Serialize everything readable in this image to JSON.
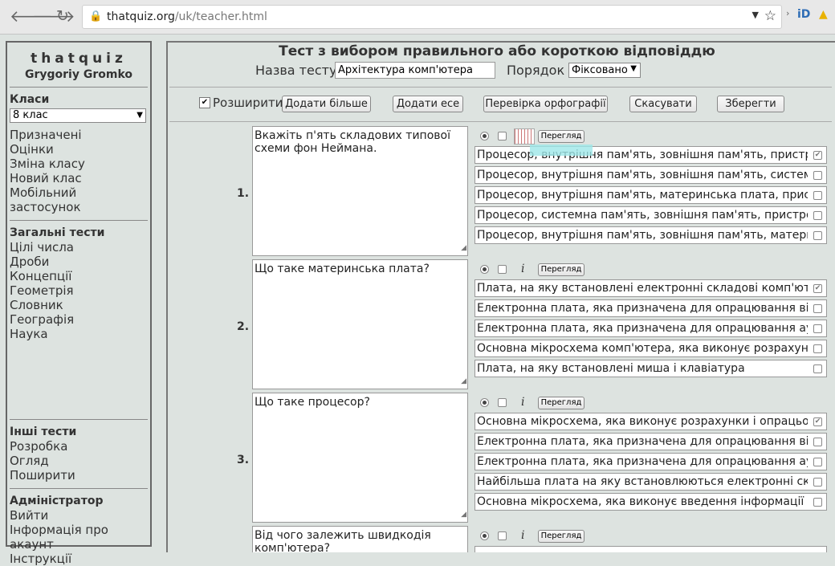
{
  "browser": {
    "url_host": "thatquiz.org",
    "url_path": "/uk/teacher.html"
  },
  "sidebar": {
    "logo": "thatquiz",
    "owner": "Grygoriy Gromko",
    "classes_heading": "Класи",
    "class_selected": "8 клас",
    "class_links": [
      "Призначені",
      "Оцінки",
      "Зміна класу",
      "Новий клас",
      "Мобільний застосунок"
    ],
    "general_heading": "Загальні тести",
    "general_links": [
      "Цілі числа",
      "Дроби",
      "Концепції",
      "Геометрія",
      "Словник",
      "Географія",
      "Наука"
    ],
    "other_heading": "Інші тести",
    "other_links": [
      "Розробка",
      "Огляд",
      "Поширити"
    ],
    "admin_heading": "Адміністратор",
    "admin_links": [
      "Вийти",
      "Інформація про акаунт",
      "Інструкції"
    ]
  },
  "main": {
    "title": "Тест з вибором правильного або короткою відповіддю",
    "name_label": "Назва тесту :",
    "name_value": "Архітектура комп'ютера",
    "order_label": "Порядок :",
    "order_value": "Фіксовано",
    "expand_label": "Розширити",
    "buttons": {
      "add_more": "Додати більше",
      "add_all": "Додати есе",
      "spellcheck": "Перевірка орфографії",
      "cancel": "Скасувати",
      "save": "Зберегти"
    },
    "preview_label": "Перегляд",
    "info_symbol": "i",
    "questions": [
      {
        "number": "1.",
        "text": "Вкажіть п'ять складових типової схеми фон Неймана.",
        "answers": [
          "Процесор, внутрішня пам'ять, зовнішня пам'ять, пристрої введення",
          "Процесор, внутрішня пам'ять, зовнішня пам'ять, системний блок",
          "Процесор, внутрішня пам'ять, материнська плата, пристрої введення",
          "Процесор, системна пам'ять, зовнішня пам'ять, пристрої введення",
          "Процесор, внутрішня пам'ять, зовнішня пам'ять, материнська карта"
        ]
      },
      {
        "number": "2.",
        "text": "Що таке материнська плата?",
        "answers": [
          "Плата, на яку встановлені електронні складові комп'ютера",
          "Електронна плата, яка призначена для опрацювання відеоданих",
          "Електронна плата, яка призначена для опрацювання аудіоданих",
          "Основна мікросхема комп'ютера, яка виконує розрахунки",
          "Плата, на яку встановлені миша і клавіатура"
        ]
      },
      {
        "number": "3.",
        "text": "Що таке процесор?",
        "answers": [
          "Основна мікросхема, яка виконує розрахунки і опрацьовує інформацію",
          "Електронна плата, яка призначена для опрацювання відеоданих",
          "Електронна плата, яка призначена для опрацювання аудіоданих",
          "Найбільша плата на яку встановлюються електронні складові комп'ютера",
          "Основна мікросхема, яка виконує введення інформації"
        ]
      },
      {
        "number": "4.",
        "text": "Від чого залежить швидкодія комп'ютера?",
        "answers": []
      }
    ]
  }
}
